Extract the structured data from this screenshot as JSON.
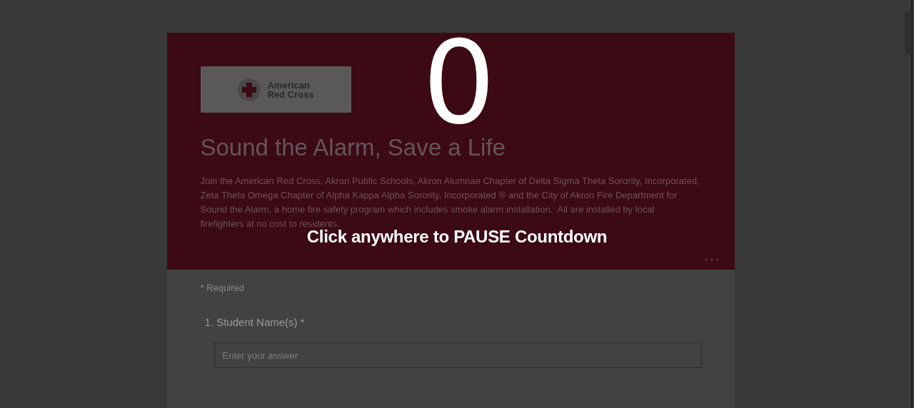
{
  "logo": {
    "lines": [
      "American",
      "Red Cross"
    ]
  },
  "header": {
    "title": "Sound the Alarm, Save a Life",
    "description": "Join the American Red Cross, Akron Public Schools, Akron Alumnae Chapter of Delta Sigma Theta Sorority, Incorporated,  Zeta Theta Omega Chapter of Alpha Kappa Alpha Sorority, Incorporated ® and the City of Akron Fire Department for Sound the Alarm, a home fire safety program which includes smoke alarm installation.  All are installed by local firefighters at no cost to residents."
  },
  "form": {
    "required_note": "* Required",
    "questions": [
      {
        "number": "1.",
        "label": "Student Name(s)",
        "required_mark": "*",
        "placeholder": "Enter your answer"
      }
    ]
  },
  "countdown": {
    "value": "0",
    "message": "Click anywhere to PAUSE Countdown"
  }
}
